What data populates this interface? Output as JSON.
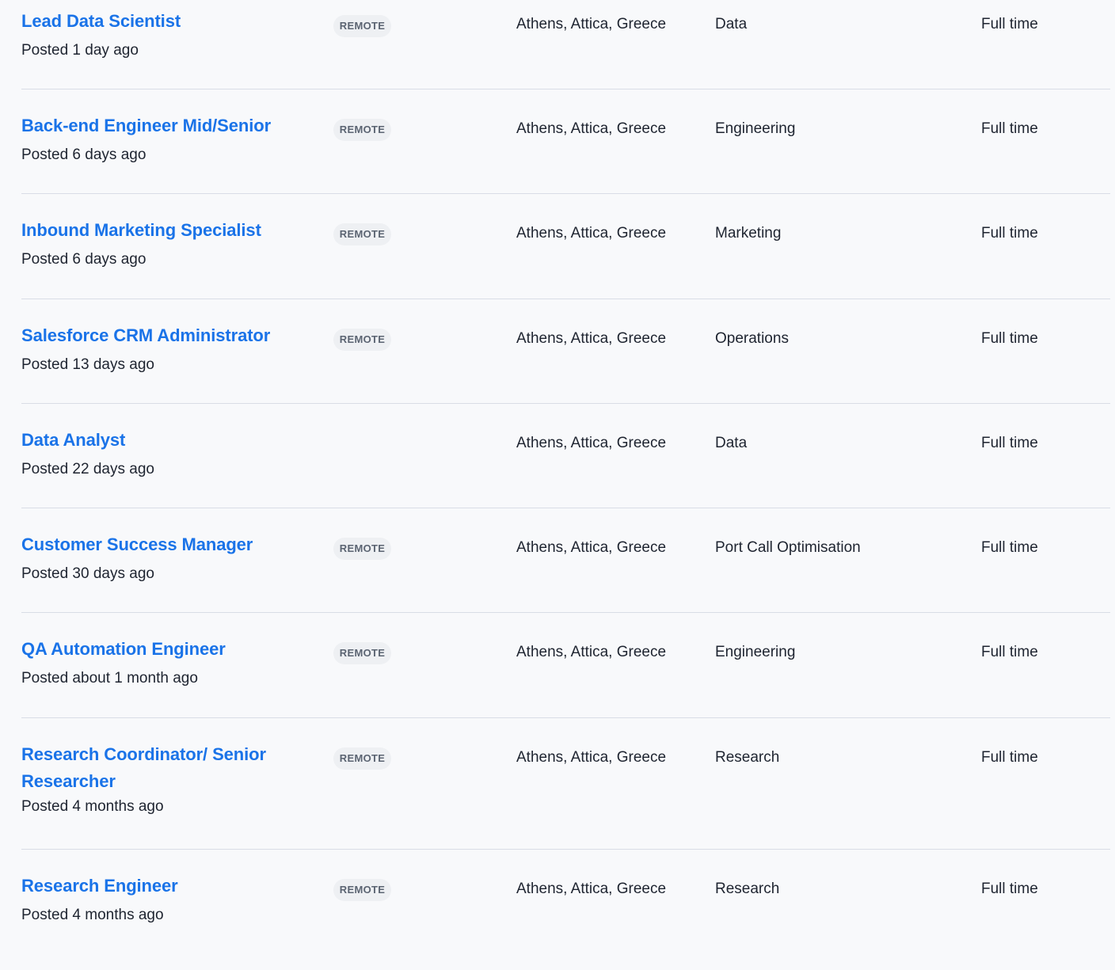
{
  "jobs": [
    {
      "title": "Lead Data Scientist",
      "posted": "Posted 1 day ago",
      "badge": "REMOTE",
      "location": "Athens, Attica, Greece",
      "department": "Data",
      "type": "Full time"
    },
    {
      "title": "Back-end Engineer Mid/Senior",
      "posted": "Posted 6 days ago",
      "badge": "REMOTE",
      "location": "Athens, Attica, Greece",
      "department": "Engineering",
      "type": "Full time"
    },
    {
      "title": "Inbound Marketing Specialist",
      "posted": "Posted 6 days ago",
      "badge": "REMOTE",
      "location": "Athens, Attica, Greece",
      "department": "Marketing",
      "type": "Full time"
    },
    {
      "title": "Salesforce CRM Administrator",
      "posted": "Posted 13 days ago",
      "badge": "REMOTE",
      "location": "Athens, Attica, Greece",
      "department": "Operations",
      "type": "Full time"
    },
    {
      "title": "Data Analyst",
      "posted": "Posted 22 days ago",
      "badge": null,
      "location": "Athens, Attica, Greece",
      "department": "Data",
      "type": "Full time"
    },
    {
      "title": "Customer Success Manager",
      "posted": "Posted 30 days ago",
      "badge": "REMOTE",
      "location": "Athens, Attica, Greece",
      "department": "Port Call Optimisation",
      "type": "Full time"
    },
    {
      "title": "QA Automation Engineer",
      "posted": "Posted about 1 month ago",
      "badge": "REMOTE",
      "location": "Athens, Attica, Greece",
      "department": "Engineering",
      "type": "Full time"
    },
    {
      "title": "Research Coordinator/ Senior Researcher",
      "posted": "Posted 4 months ago",
      "badge": "REMOTE",
      "location": "Athens, Attica, Greece",
      "department": "Research",
      "type": "Full time"
    },
    {
      "title": "Research Engineer",
      "posted": "Posted 4 months ago",
      "badge": "REMOTE",
      "location": "Athens, Attica, Greece",
      "department": "Research",
      "type": "Full time"
    }
  ],
  "colors": {
    "title_link": "#1a73e8",
    "text": "#1e2430",
    "badge_bg": "#eef0f3",
    "badge_text": "#5b6472",
    "divider": "#d9dde6",
    "background": "#f8f9fb"
  }
}
